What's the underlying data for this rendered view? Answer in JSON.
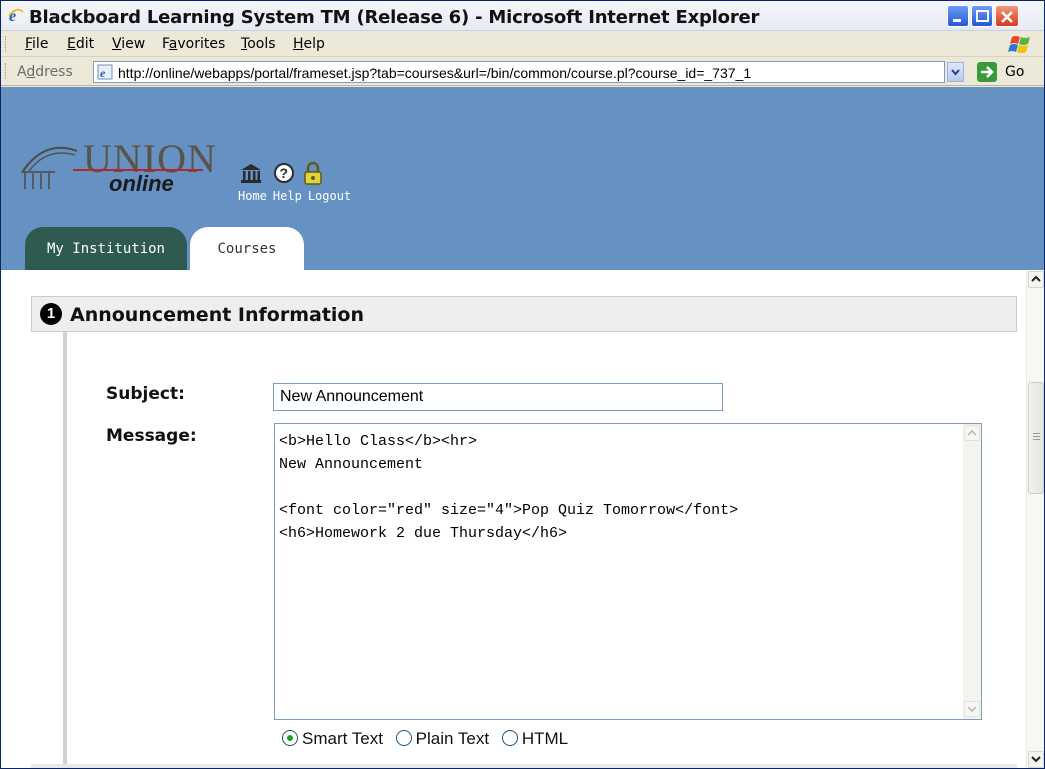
{
  "window": {
    "title": "Blackboard Learning System TM (Release 6) - Microsoft Internet Explorer"
  },
  "menubar": {
    "items": [
      {
        "key": "F",
        "rest": "ile"
      },
      {
        "key": "E",
        "rest": "dit"
      },
      {
        "key": "V",
        "rest": "iew"
      },
      {
        "pre": "F",
        "key": "a",
        "rest": "vorites"
      },
      {
        "key": "T",
        "rest": "ools"
      },
      {
        "key": "H",
        "rest": "elp"
      }
    ]
  },
  "address": {
    "label_pre": "A",
    "label_key": "d",
    "label_rest": "dress",
    "url": "http://online/webapps/portal/frameset.jsp?tab=courses&url=/bin/common/course.pl?course_id=_737_1",
    "go_label": "Go"
  },
  "header": {
    "logo_union": "UNION",
    "logo_online": "online",
    "links": [
      "Home",
      "Help",
      "Logout"
    ],
    "tabs": [
      "My Institution",
      "Courses"
    ]
  },
  "form": {
    "step_number": "1",
    "section_title": "Announcement Information",
    "subject_label": "Subject:",
    "subject_value": "New Announcement",
    "message_label": "Message:",
    "message_value": "<b>Hello Class</b><hr>\nNew Announcement\n\n<font color=\"red\" size=\"4\">Pop Quiz Tomorrow</font>\n<h6>Homework 2 due Thursday</h6>",
    "format_options": [
      "Smart Text",
      "Plain Text",
      "HTML"
    ],
    "format_selected": "Smart Text"
  },
  "colors": {
    "header_bg": "#6591c3",
    "tab_active_bg": "#ffffff",
    "tab_inactive_bg": "#2e5a4f",
    "section_bg": "#eeeeee"
  }
}
